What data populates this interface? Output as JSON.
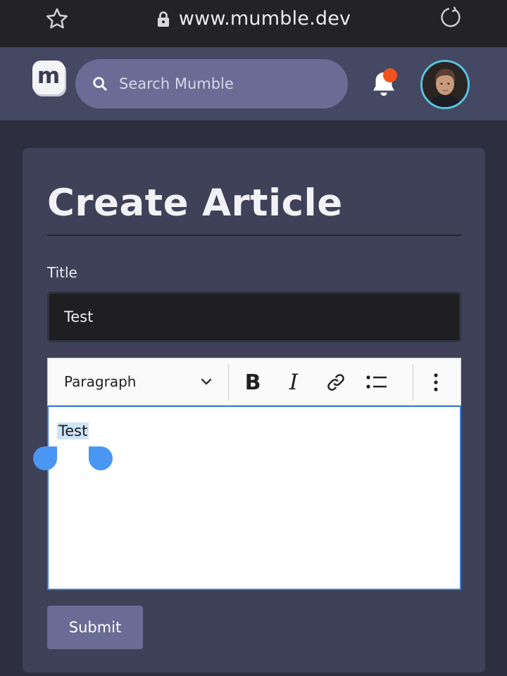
{
  "browser": {
    "url": "www.mumble.dev",
    "icons": [
      "star-icon",
      "lock-icon",
      "reload-icon"
    ]
  },
  "header": {
    "logo_text": "m",
    "search_placeholder": "Search Mumble",
    "notification_badge_color": "#f2521e",
    "avatar_ring_color": "#58c4e0"
  },
  "page": {
    "title": "Create Article",
    "title_field_label": "Title",
    "title_field_value": "Test"
  },
  "editor": {
    "heading_style": "Paragraph",
    "toolbar_icons": [
      "bold-icon",
      "italic-icon",
      "link-icon",
      "bulleted-list-icon",
      "more-vertical-icon"
    ],
    "content_text": "Test",
    "selection_color": "#cde3f7",
    "focus_border_color": "#3d7fd6"
  },
  "actions": {
    "submit_label": "Submit"
  },
  "colors": {
    "accent": "#6a6c96",
    "header_bg": "#454862",
    "card_bg": "#3e4157",
    "page_bg": "#2d2e3f"
  }
}
